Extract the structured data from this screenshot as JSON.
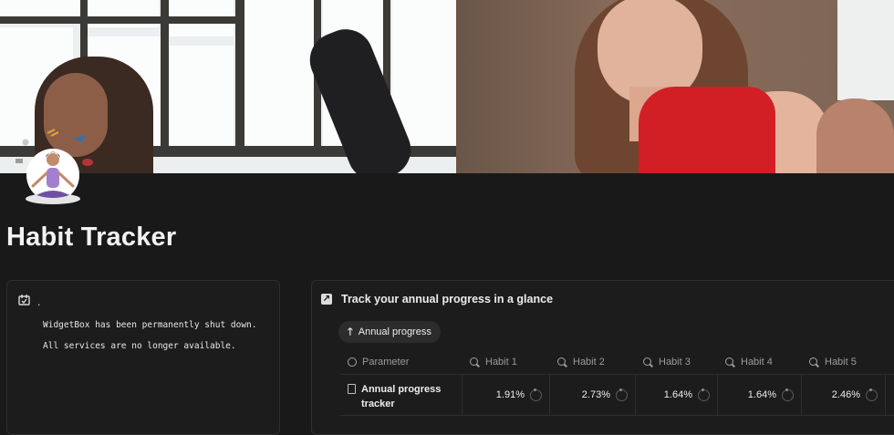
{
  "page": {
    "title": "Habit Tracker"
  },
  "embed": {
    "header_text": ".",
    "messages": [
      "WidgetBox has been permanently shut down.",
      "All services are no longer available."
    ]
  },
  "callout": {
    "title": "Track your annual progress in a glance"
  },
  "view_tab": {
    "label": "Annual progress"
  },
  "table": {
    "columns": [
      "Parameter",
      "Habit 1",
      "Habit 2",
      "Habit 3",
      "Habit 4",
      "Habit 5"
    ],
    "rows": [
      {
        "name_line1": "Annual progress",
        "name_line2": "tracker",
        "values": [
          "1.91%",
          "2.73%",
          "1.64%",
          "1.64%",
          "2.46%"
        ]
      }
    ]
  },
  "icons": {
    "cover": "cover-photo",
    "page_icon": "meditation-icon",
    "embed": "widget-icon",
    "callout": "arrow-up-right-icon",
    "view_tab": "arrow-up-icon",
    "parameter": "circle-icon",
    "habit_columns": "search-icon",
    "row": "document-icon",
    "progress": "progress-ring-icon"
  }
}
